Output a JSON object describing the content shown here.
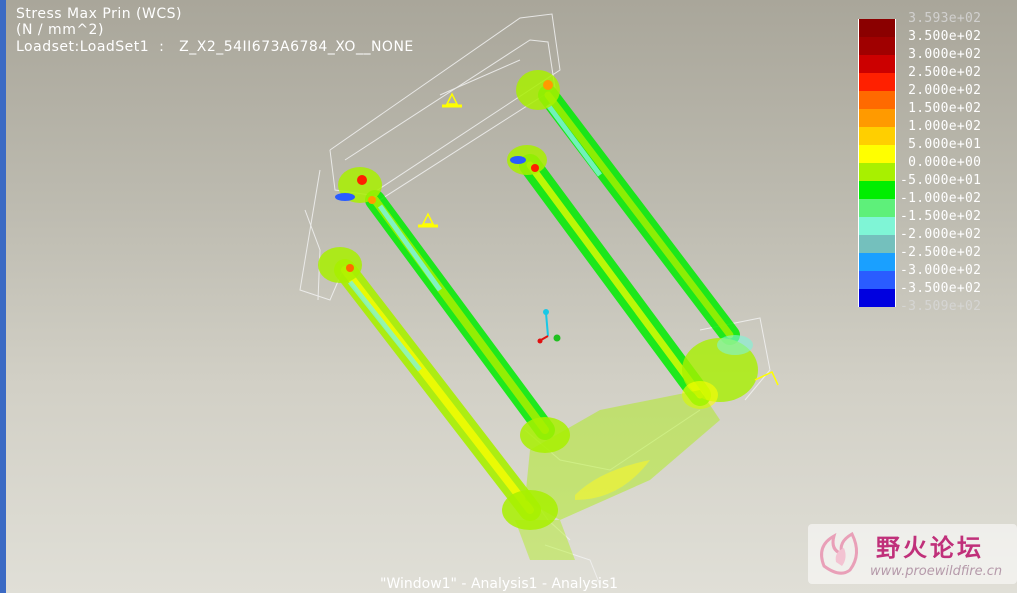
{
  "window": {
    "title": "Stress Max Prin (WCS)",
    "units": "(N / mm^2)",
    "loadset": "Loadset:LoadSet1  :   Z_X2_54II673A6784_XO__NONE",
    "footer": "\"Window1\" - Analysis1 - Analysis1"
  },
  "legend": {
    "entries": [
      {
        "label": " 3.593e+02",
        "color": "#8b0000",
        "dim": true
      },
      {
        "label": " 3.500e+02",
        "color": "#a00000"
      },
      {
        "label": " 3.000e+02",
        "color": "#cc0000"
      },
      {
        "label": " 2.500e+02",
        "color": "#ff2000"
      },
      {
        "label": " 2.000e+02",
        "color": "#ff6a00"
      },
      {
        "label": " 1.500e+02",
        "color": "#ff9a00"
      },
      {
        "label": " 1.000e+02",
        "color": "#ffcf00"
      },
      {
        "label": " 5.000e+01",
        "color": "#ffff00"
      },
      {
        "label": " 0.000e+00",
        "color": "#a8f000"
      },
      {
        "label": "-5.000e+01",
        "color": "#00ee00"
      },
      {
        "label": "-1.000e+02",
        "color": "#5ef07a"
      },
      {
        "label": "-1.500e+02",
        "color": "#7ff5d6"
      },
      {
        "label": "-2.000e+02",
        "color": "#74c0bd"
      },
      {
        "label": "-2.500e+02",
        "color": "#1aa0ff"
      },
      {
        "label": "-3.000e+02",
        "color": "#2a5cff"
      },
      {
        "label": "-3.500e+02",
        "color": "#0000e0"
      },
      {
        "label": "-3.509e+02",
        "color": "#2a2a7a",
        "dim": true
      }
    ]
  },
  "watermark": {
    "title": "野火论坛",
    "url": "www.proewildfire.cn"
  }
}
